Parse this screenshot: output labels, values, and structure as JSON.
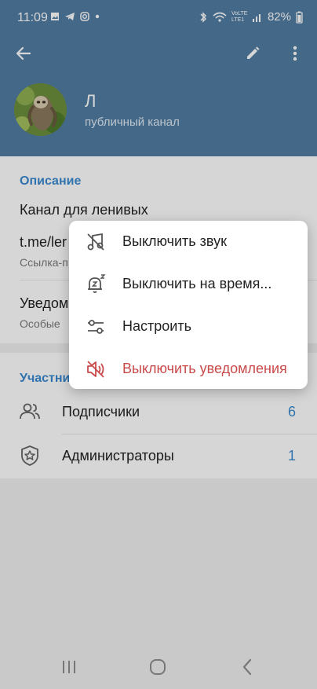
{
  "status": {
    "time": "11:09",
    "battery": "82%",
    "signal_text": "VoLTE LTE1"
  },
  "header": {
    "title": "Л",
    "subtitle": "публичный канал"
  },
  "info": {
    "section_title": "Описание",
    "description": "Канал для ленивых",
    "link": "t.me/ler",
    "link_caption": "Ссылка-п",
    "notifications_title": "Уведом",
    "notifications_value": "Особые"
  },
  "members": {
    "section_title": "Участни",
    "rows": [
      {
        "label": "Подписчики",
        "count": "6",
        "icon": "people-icon"
      },
      {
        "label": "Администраторы",
        "count": "1",
        "icon": "shield-star-icon"
      }
    ]
  },
  "menu": {
    "items": [
      {
        "label": "Выключить звук",
        "icon": "mute-icon"
      },
      {
        "label": "Выключить на время...",
        "icon": "snooze-bell-icon"
      },
      {
        "label": "Настроить",
        "icon": "sliders-icon"
      },
      {
        "label": "Выключить уведомления",
        "icon": "notifications-off-icon",
        "danger": true
      }
    ]
  },
  "colors": {
    "brand": "#527da3",
    "accent": "#3a8ad0",
    "danger": "#c94a4a"
  }
}
